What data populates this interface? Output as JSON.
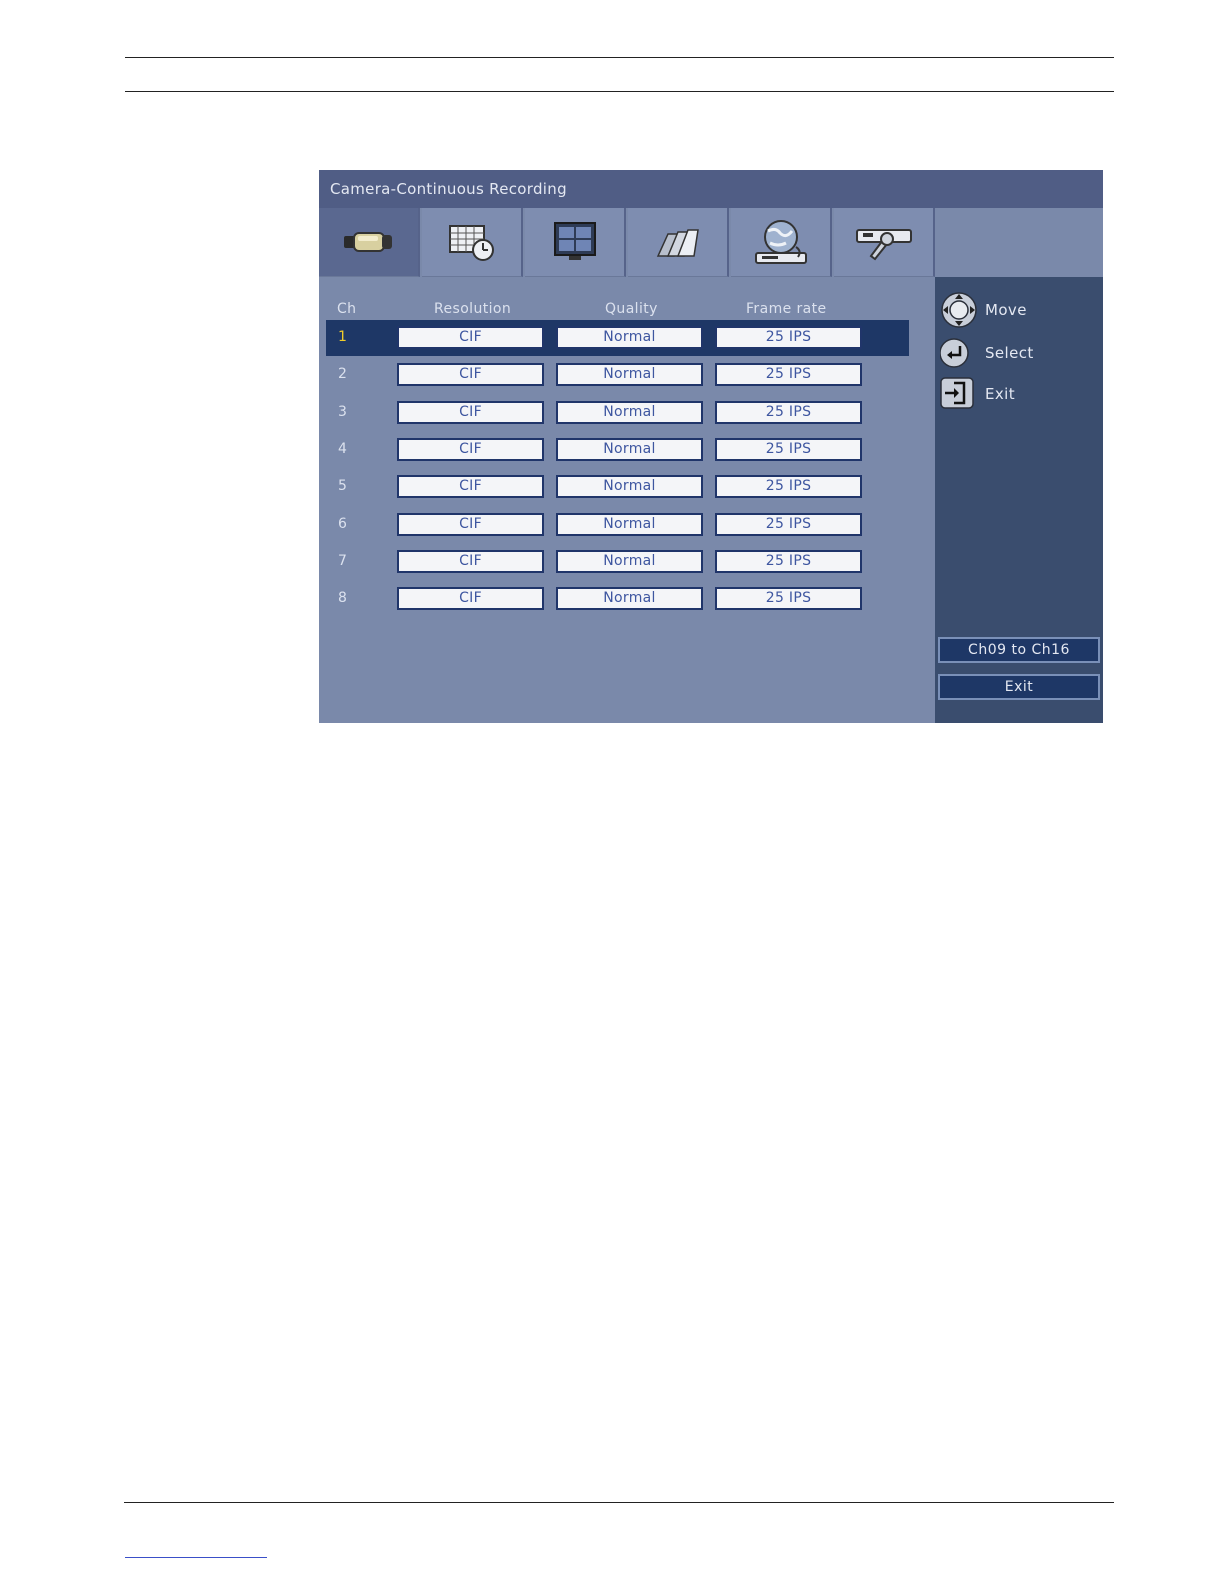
{
  "window": {
    "title": "Camera-Continuous Recording"
  },
  "tabs": [
    {
      "name": "camera"
    },
    {
      "name": "schedule"
    },
    {
      "name": "display"
    },
    {
      "name": "archive"
    },
    {
      "name": "network"
    },
    {
      "name": "system-tools"
    }
  ],
  "columns": {
    "ch": "Ch",
    "resolution": "Resolution",
    "quality": "Quality",
    "frame_rate": "Frame rate"
  },
  "rows": [
    {
      "ch": "1",
      "resolution": "CIF",
      "quality": "Normal",
      "frame_rate": "25  IPS"
    },
    {
      "ch": "2",
      "resolution": "CIF",
      "quality": "Normal",
      "frame_rate": "25  IPS"
    },
    {
      "ch": "3",
      "resolution": "CIF",
      "quality": "Normal",
      "frame_rate": "25  IPS"
    },
    {
      "ch": "4",
      "resolution": "CIF",
      "quality": "Normal",
      "frame_rate": "25  IPS"
    },
    {
      "ch": "5",
      "resolution": "CIF",
      "quality": "Normal",
      "frame_rate": "25  IPS"
    },
    {
      "ch": "6",
      "resolution": "CIF",
      "quality": "Normal",
      "frame_rate": "25  IPS"
    },
    {
      "ch": "7",
      "resolution": "CIF",
      "quality": "Normal",
      "frame_rate": "25  IPS"
    },
    {
      "ch": "8",
      "resolution": "CIF",
      "quality": "Normal",
      "frame_rate": "25  IPS"
    }
  ],
  "selected_row": "1",
  "hints": {
    "move": "Move",
    "select": "Select",
    "exit": "Exit"
  },
  "buttons": {
    "next_channels": "Ch09  to  Ch16",
    "exit": "Exit"
  },
  "colors": {
    "selected_row": "#1e3766",
    "selected_channel_text": "#f0cc2a",
    "panel": "#7a89aa",
    "side_panel": "#3a4d6e"
  }
}
